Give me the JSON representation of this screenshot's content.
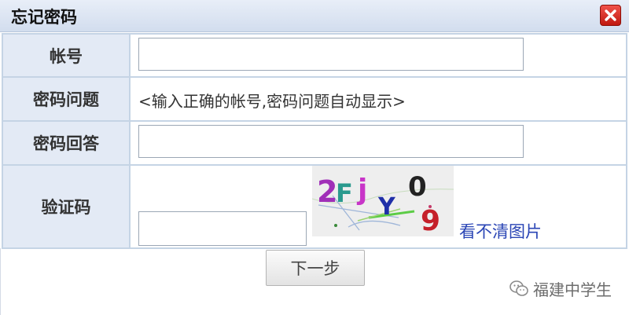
{
  "dialog": {
    "title": "忘记密码",
    "close_icon": "close-icon",
    "accent_color": "#d42a1e"
  },
  "form": {
    "account_label": "帐号",
    "account_value": "",
    "question_label": "密码问题",
    "question_hint": "<输入正确的帐号,密码问题自动显示>",
    "answer_label": "密码回答",
    "answer_value": "",
    "captcha_label": "验证码",
    "captcha_value": "",
    "captcha_image_text": "2Fj Y 0 9",
    "captcha_refresh_link": "看不清图片"
  },
  "actions": {
    "next_label": "下一步"
  },
  "watermark": {
    "icon": "wechat-icon",
    "text": "福建中学生"
  }
}
